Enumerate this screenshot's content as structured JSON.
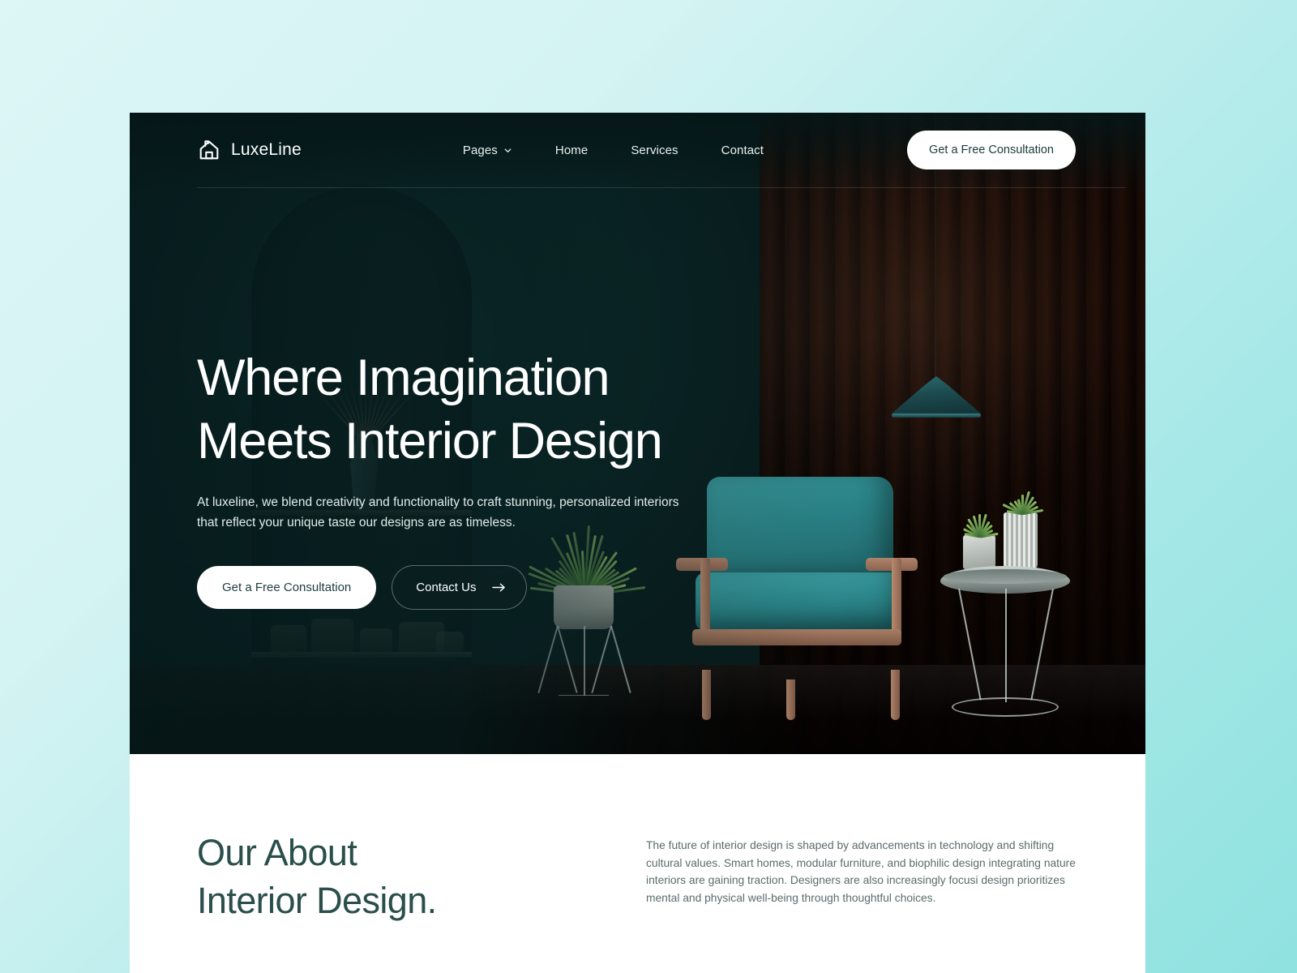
{
  "brand": {
    "name": "LuxeLine",
    "icon": "house-icon"
  },
  "nav": {
    "links": [
      {
        "label": "Pages",
        "icon": "chevron-down-icon",
        "has_dropdown": true
      },
      {
        "label": "Home",
        "has_dropdown": false
      },
      {
        "label": "Services",
        "has_dropdown": false
      },
      {
        "label": "Contact",
        "has_dropdown": false
      }
    ],
    "cta_label": "Get a Free Consultation"
  },
  "hero": {
    "title_line1": "Where Imagination",
    "title_line2": "Meets Interior Design",
    "subtitle": "At luxeline, we blend creativity and functionality to craft stunning, personalized interiors that reflect your unique taste our designs are as timeless.",
    "primary_button": "Get a Free Consultation",
    "secondary_button": "Contact Us",
    "secondary_button_icon": "arrow-right-icon"
  },
  "about": {
    "title": "Our About\nInterior Design.",
    "paragraph": "The future of interior design is shaped by advancements in technology and shifting cultural values. Smart homes, modular furniture, and biophilic design integrating nature interiors are gaining traction. Designers are also increasingly focusi design prioritizes mental and physical well-being through thoughtful choices."
  },
  "colors": {
    "page_background_light": "#d4f3f3",
    "page_background_accent": "#8fe2e0",
    "hero_dark": "#0d211f",
    "heading_teal": "#2a4f4b",
    "body_text": "#5c6b6b",
    "button_white": "#ffffff",
    "accent_teal": "#2b8488",
    "wood_brown": "#5a3c2d"
  }
}
